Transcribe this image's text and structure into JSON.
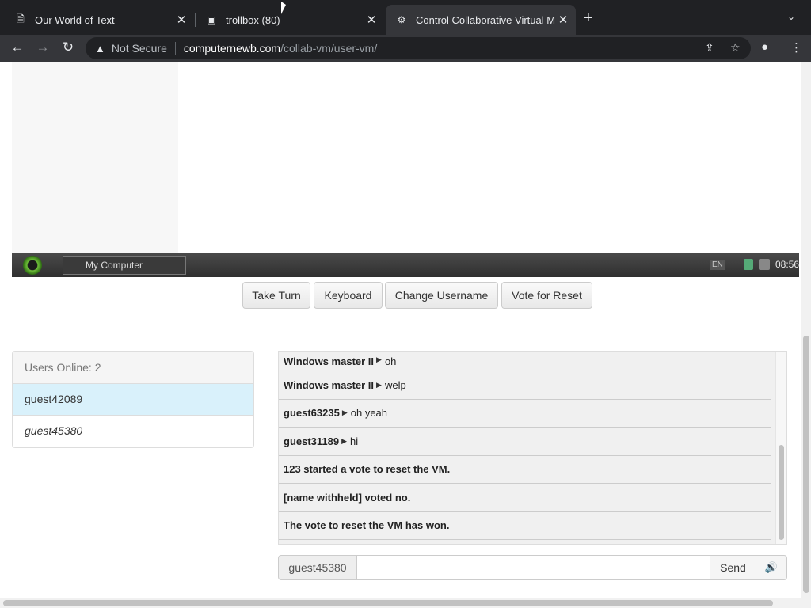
{
  "tabs": [
    {
      "title": "Our World of Text",
      "favicon": "owot-favicon-icon"
    },
    {
      "title": "trollbox (80)",
      "favicon": "trollbox-favicon-icon"
    },
    {
      "title": "Control Collaborative Virtual M",
      "favicon": "collabvm-favicon-icon",
      "active": true
    }
  ],
  "toolbar": {
    "security_label": "Not Secure",
    "url_host": "computernewb.com",
    "url_path": "/collab-vm/user-vm/"
  },
  "vm": {
    "taskbar_item": "My Computer",
    "lang": "EN",
    "clock": "08:56"
  },
  "controls": {
    "take_turn": "Take Turn",
    "keyboard": "Keyboard",
    "change_username": "Change Username",
    "vote_reset": "Vote for Reset"
  },
  "users": {
    "header": "Users Online: 2",
    "list": [
      "guest42089",
      "guest45380"
    ]
  },
  "chat": {
    "messages": [
      {
        "user": "Windows master II",
        "text": "oh"
      },
      {
        "user": "Windows master II",
        "text": "welp"
      },
      {
        "user": "guest63235",
        "text": "oh yeah"
      },
      {
        "user": "guest31189",
        "text": "hi"
      },
      {
        "system": "123 started a vote to reset the VM."
      },
      {
        "system": "[name withheld] voted no."
      },
      {
        "system": "The vote to reset the VM has won."
      }
    ]
  },
  "input": {
    "username": "guest45380",
    "value": "",
    "send_label": "Send"
  },
  "colors": {
    "chrome_dark": "#202124",
    "chrome_toolbar": "#35363a",
    "selected_user": "#d9f1fb"
  }
}
